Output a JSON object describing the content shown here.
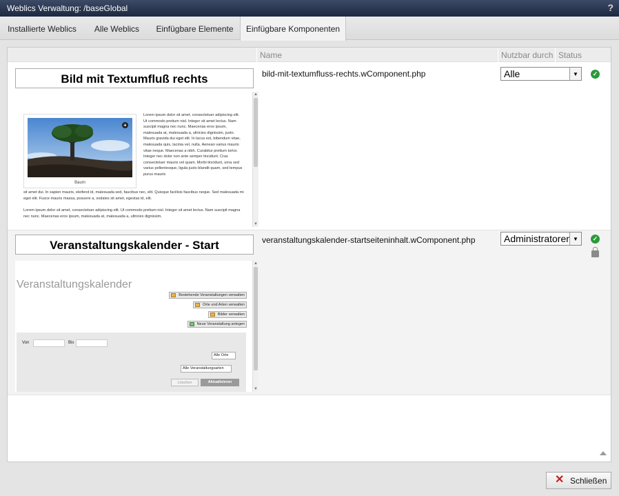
{
  "window": {
    "title": "Weblics Verwaltung: /baseGlobal",
    "help_label": "?"
  },
  "tabs": [
    {
      "label": "Installierte Weblics"
    },
    {
      "label": "Alle Weblics"
    },
    {
      "label": "Einfügbare Elemente"
    },
    {
      "label": "Einfügbare Komponenten",
      "active": true
    }
  ],
  "table": {
    "columns": {
      "name": "Name",
      "usable_by": "Nutzbar durch",
      "status": "Status"
    },
    "rows": [
      {
        "preview_title": "Bild mit Textumfluß rechts",
        "filename": "bild-mit-textumfluss-rechts.wComponent.php",
        "usable_by": "Alle",
        "status": "active",
        "preview": {
          "caption": "Baum",
          "text_right": "Lorem ipsum dolor sit amet, consectetuer adipiscing elit. Ut commodo pretium nisl. Integer sit amet lectus. Nam suscipit magna nec nunc. Maecenas eros ipsum, malesuada at, malesuada a, ultricies dignissim, justo. Mauris gravida dui eget elit. In lacus est, bibendum vitae, malesuada quis, lacinia vel, nulla. Aenean varius mauris vitae neque. Maecenas a nibh. Curabitur pretium tortor. Integer nec dolor non ante semper tincidunt. Cras consectetuer mauris vel quam. Morbi tincidunt, urna sed varius pellentesque, ligula justo blandit quam, sed tempus purus mauris",
          "text_bottom_1": "sit amet dui. In sapien mauris, eleifend id, malesuada sed, faucibus nec, elit. Quisque facilisis faucibus neque. Sed malesuada mi eget elit. Fusce mauris massa, posuere a, sodales sit amet, egestas id, elit.",
          "text_bottom_2": "Lorem ipsum dolor sit amet, consectetuer adipiscing elit. Ut commodo pretium nisl. Integer sit amet lectus. Nam suscipit magna nec nunc. Maecenas eros ipsum, malesuada at, malesuada a, ultricies dignissim,"
        }
      },
      {
        "preview_title": "Veranstaltungskalender - Start",
        "filename": "veranstaltungskalender-startseiteninhalt.wComponent.php",
        "usable_by": "Administratoren",
        "status": "active-locked",
        "preview": {
          "heading": "Veranstaltungskalender",
          "buttons": [
            "Bestehende Veranstaltungen verwalten",
            "Orte und Arten verwalten",
            "Bilder verwalten",
            "Neue Veranstaltung anlegen"
          ],
          "from_label": "Von",
          "to_label": "Bis",
          "place_select": "Alle Orte",
          "type_select": "Alle Veranstaltungsarten",
          "delete_label": "Löschen",
          "update_label": "Aktualisieren"
        }
      }
    ]
  },
  "footer": {
    "close_label": "Schließen"
  },
  "colors": {
    "titlebar": "#1d2840",
    "ok": "#2a9a3a",
    "close_x": "#c51e1e"
  }
}
